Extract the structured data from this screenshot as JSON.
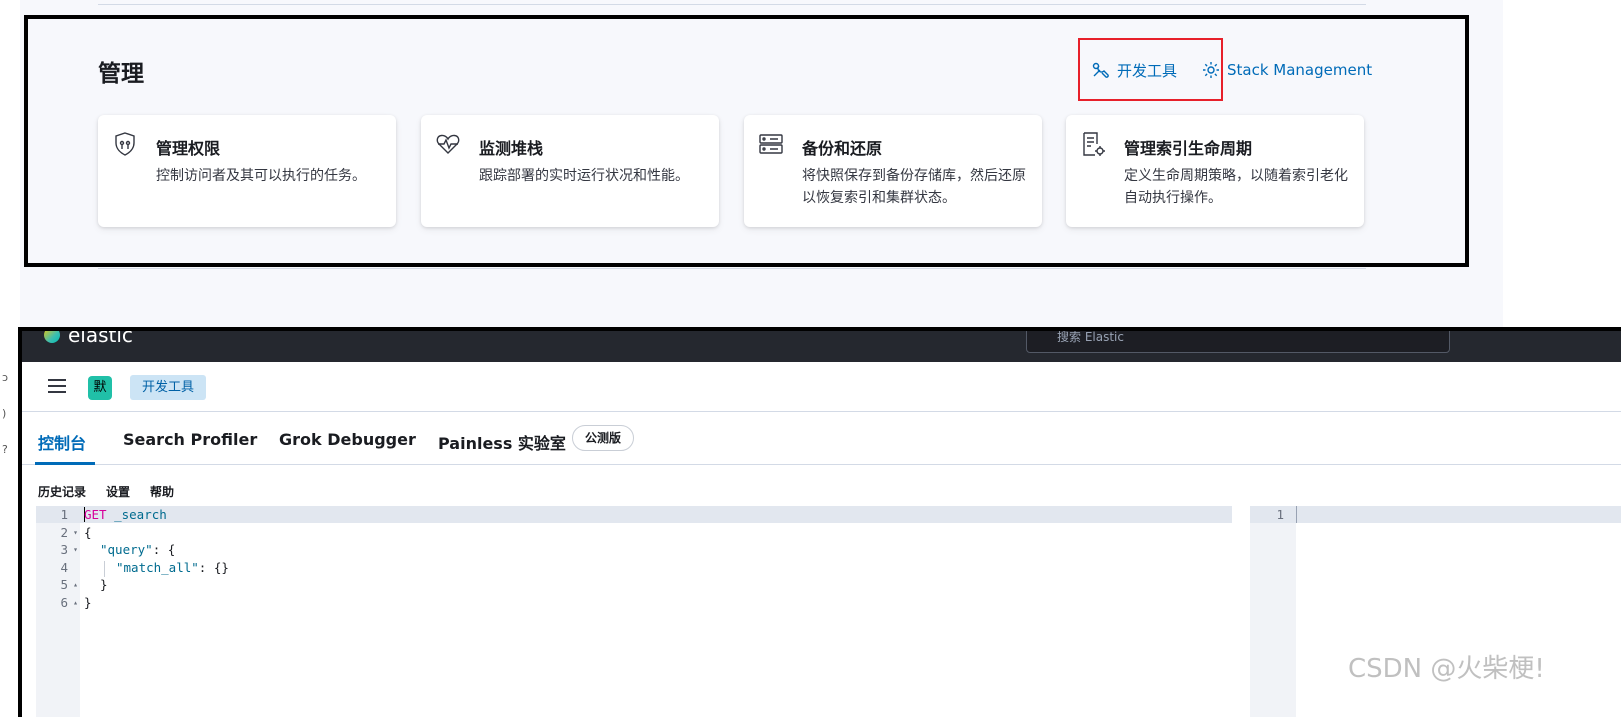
{
  "management": {
    "title": "管理",
    "dev_tools_link": "开发工具",
    "stack_management_link": "Stack Management",
    "cards": [
      {
        "icon": "shield-icon",
        "title": "管理权限",
        "desc": "控制访问者及其可以执行的任务。"
      },
      {
        "icon": "heartbeat-icon",
        "title": "监测堆栈",
        "desc": "跟踪部署的实时运行状况和性能。"
      },
      {
        "icon": "server-icon",
        "title": "备份和还原",
        "desc": "将快照保存到备份存储库，然后还原以恢复索引和集群状态。"
      },
      {
        "icon": "document-settings-icon",
        "title": "管理索引生命周期",
        "desc": "定义生命周期策略，以随着索引老化自动执行操作。"
      }
    ]
  },
  "header": {
    "logo_text": "elastic",
    "search_placeholder": "搜索 Elastic",
    "space_badge": "默",
    "breadcrumb": "开发工具"
  },
  "tabs": {
    "console": "控制台",
    "search_profiler": "Search Profiler",
    "grok_debugger": "Grok Debugger",
    "painless_lab": "Painless 实验室",
    "beta_badge": "公测版"
  },
  "toolbar": {
    "history": "历史记录",
    "settings": "设置",
    "help": "帮助"
  },
  "editor": {
    "line_numbers": [
      "1",
      "2",
      "3",
      "4",
      "5",
      "6"
    ],
    "method": "GET",
    "endpoint": "_search",
    "line2": "{",
    "line3_key": "\"query\"",
    "line3_rest": ": {",
    "line4_key": "\"match_all\"",
    "line4_rest": ": {}",
    "line5": "}",
    "line6": "}"
  },
  "output": {
    "line_number": "1"
  },
  "watermark": "CSDN @火柴梗!"
}
